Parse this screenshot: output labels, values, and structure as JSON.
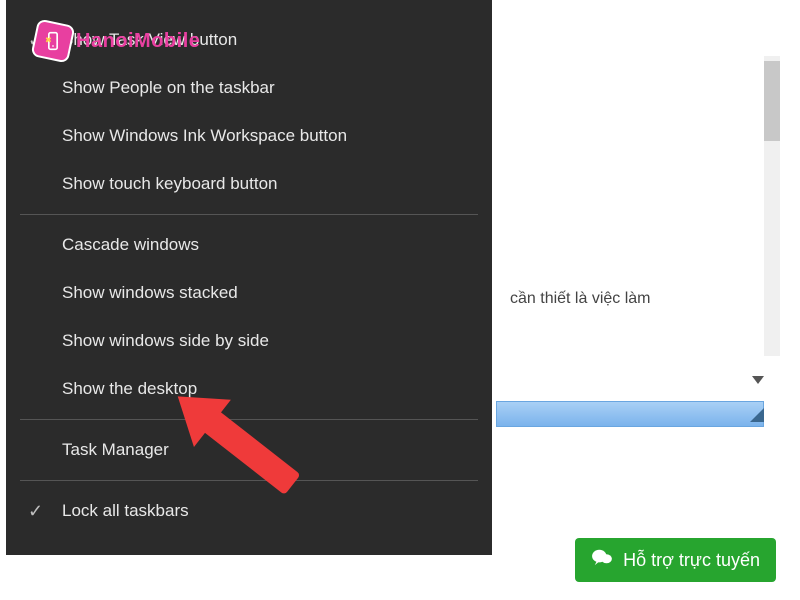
{
  "watermark": {
    "text": "HanoiMobile"
  },
  "contextMenu": {
    "group1": [
      {
        "label": "Show Task View button",
        "checked": true
      },
      {
        "label": "Show People on the taskbar",
        "checked": false
      },
      {
        "label": "Show Windows Ink Workspace button",
        "checked": false
      },
      {
        "label": "Show touch keyboard button",
        "checked": false
      }
    ],
    "group2": [
      {
        "label": "Cascade windows"
      },
      {
        "label": "Show windows stacked"
      },
      {
        "label": "Show windows side by side"
      },
      {
        "label": "Show the desktop"
      }
    ],
    "group3": [
      {
        "label": "Task Manager"
      }
    ],
    "group4": [
      {
        "label": "Lock all taskbars",
        "checked": true
      }
    ]
  },
  "background": {
    "bodyTextFragment": "cần thiết là việc làm"
  },
  "chat": {
    "label": "Hỗ trợ trực tuyến"
  }
}
